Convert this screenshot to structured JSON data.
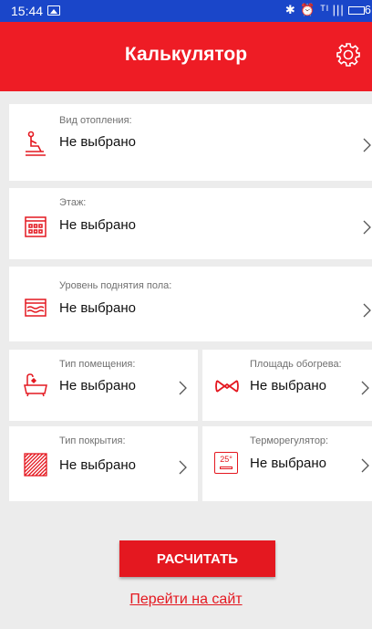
{
  "status": {
    "time": "15:44",
    "right_text": "✱ ⏰ ᵀᴵ |||",
    "battery_text": "6"
  },
  "app": {
    "title": "Калькулятор"
  },
  "rows": [
    {
      "label": "Вид отопления:",
      "value": "Не выбрано"
    },
    {
      "label": "Этаж:",
      "value": "Не выбрано"
    },
    {
      "label": "Уровень поднятия пола:",
      "value": "Не выбрано"
    }
  ],
  "room_type": {
    "label": "Тип помещения:",
    "value": "Не выбрано"
  },
  "heat_area": {
    "label": "Площадь обогрева:",
    "value": "Не выбрано"
  },
  "cover_type": {
    "label": "Тип покрытия:",
    "value": "Не выбрано"
  },
  "thermostat": {
    "label": "Терморегулятор:",
    "value": "Не выбрано",
    "icon_text": "25°"
  },
  "actions": {
    "calculate": "РАСЧИТАТЬ",
    "site_link": "Перейти на сайт"
  },
  "colors": {
    "accent": "#ee1c25",
    "statusbar": "#1a46c9"
  }
}
